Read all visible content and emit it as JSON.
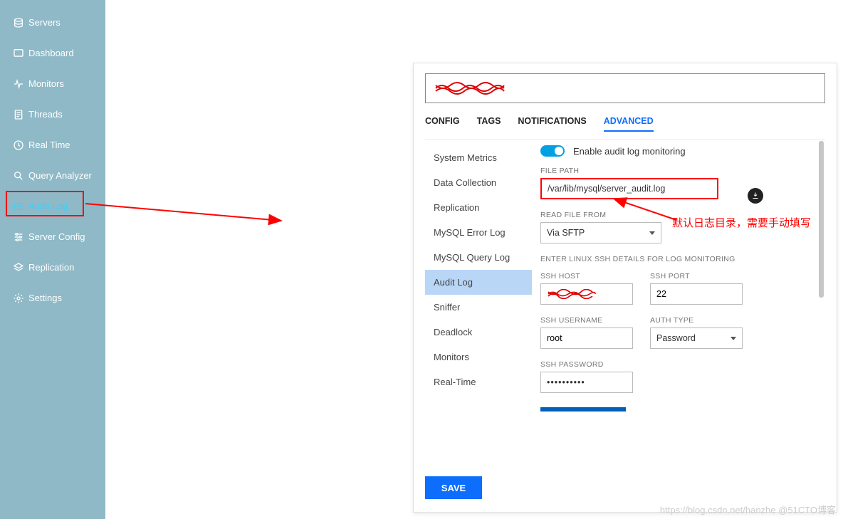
{
  "sidebar": {
    "items": [
      {
        "label": "Servers"
      },
      {
        "label": "Dashboard"
      },
      {
        "label": "Monitors"
      },
      {
        "label": "Threads"
      },
      {
        "label": "Real Time"
      },
      {
        "label": "Query Analyzer"
      },
      {
        "label": "Audit Log"
      },
      {
        "label": "Server Config"
      },
      {
        "label": "Replication"
      },
      {
        "label": "Settings"
      }
    ]
  },
  "panel": {
    "tabs": [
      "CONFIG",
      "TAGS",
      "NOTIFICATIONS",
      "ADVANCED"
    ],
    "side_list": [
      "System Metrics",
      "Data Collection",
      "Replication",
      "MySQL Error Log",
      "MySQL Query Log",
      "Audit Log",
      "Sniffer",
      "Deadlock",
      "Monitors",
      "Real-Time"
    ],
    "toggle_label": "Enable audit log monitoring",
    "file_path_label": "FILE PATH",
    "file_path_value": "/var/lib/mysql/server_audit.log",
    "read_from_label": "READ FILE FROM",
    "read_from_value": "Via SFTP",
    "ssh_section_label": "ENTER LINUX SSH DETAILS FOR LOG MONITORING",
    "ssh_host_label": "SSH HOST",
    "ssh_port_label": "SSH PORT",
    "ssh_port_value": "22",
    "ssh_user_label": "SSH USERNAME",
    "ssh_user_value": "root",
    "auth_type_label": "AUTH TYPE",
    "auth_type_value": "Password",
    "ssh_pw_label": "SSH PASSWORD",
    "ssh_pw_value": "••••••••••",
    "save_label": "SAVE"
  },
  "annotation": {
    "text": "默认日志目录，需要手动填写"
  },
  "watermark": "https://blog.csdn.net/hanzhe @51CTO博客"
}
